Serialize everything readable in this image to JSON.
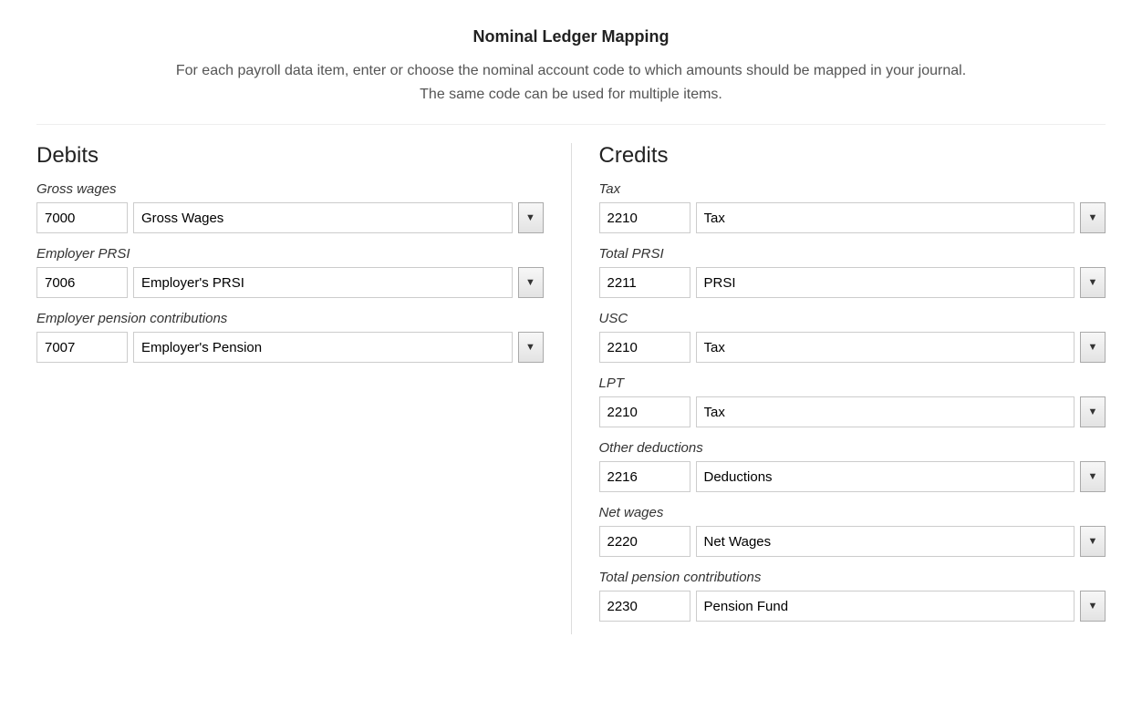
{
  "header": {
    "title": "Nominal Ledger Mapping",
    "description_line1": "For each payroll data item, enter or choose the nominal account code to which amounts should be mapped in your journal.",
    "description_line2": "The same code can be used for multiple items."
  },
  "debits": {
    "title": "Debits",
    "items": [
      {
        "label": "Gross wages",
        "code": "7000",
        "name": "Gross Wages"
      },
      {
        "label": "Employer PRSI",
        "code": "7006",
        "name": "Employer's PRSI"
      },
      {
        "label": "Employer pension contributions",
        "code": "7007",
        "name": "Employer's Pension"
      }
    ]
  },
  "credits": {
    "title": "Credits",
    "items": [
      {
        "label": "Tax",
        "code": "2210",
        "name": "Tax"
      },
      {
        "label": "Total PRSI",
        "code": "2211",
        "name": "PRSI"
      },
      {
        "label": "USC",
        "code": "2210",
        "name": "Tax"
      },
      {
        "label": "LPT",
        "code": "2210",
        "name": "Tax"
      },
      {
        "label": "Other deductions",
        "code": "2216",
        "name": "Deductions"
      },
      {
        "label": "Net wages",
        "code": "2220",
        "name": "Net Wages"
      },
      {
        "label": "Total pension contributions",
        "code": "2230",
        "name": "Pension Fund"
      }
    ]
  }
}
